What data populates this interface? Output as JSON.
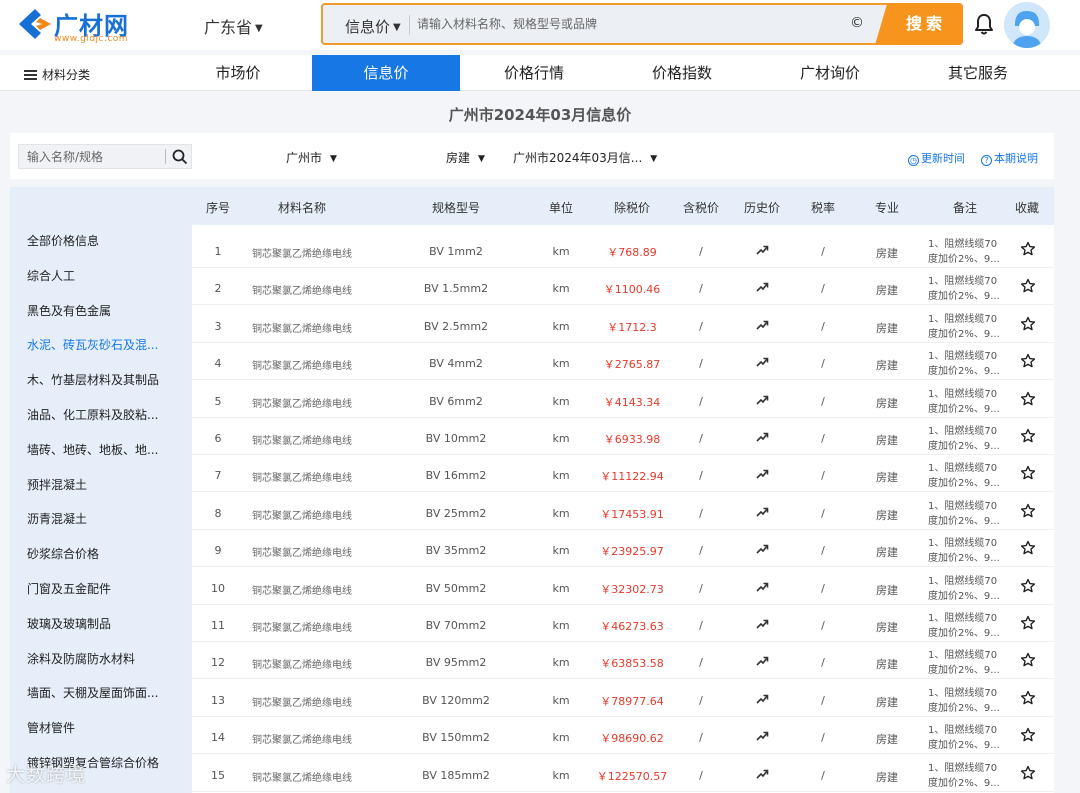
{
  "header": {
    "logo_name": "广材网",
    "logo_url": "www.gldjc.com",
    "province": "广东省",
    "search_type": "信息价",
    "search_placeholder": "请输入材料名称、规格型号或品牌",
    "copyright_symbol": "©",
    "search_button": "搜索"
  },
  "nav": {
    "category_label": "材料分类",
    "items": [
      "市场价",
      "信息价",
      "价格行情",
      "价格指数",
      "广材询价",
      "其它服务"
    ],
    "active": "信息价"
  },
  "page_title": "广州市2024年03月信息价",
  "filter": {
    "keyword_placeholder": "输入名称/规格",
    "city": "广州市",
    "major": "房建",
    "period": "广州市2024年03月信...",
    "update_time_link": "更新时间",
    "period_note_link": "本期说明"
  },
  "sidebar": {
    "items": [
      "全部价格信息",
      "综合人工",
      "黑色及有色金属",
      "水泥、砖瓦灰砂石及混...",
      "木、竹基层材料及其制品",
      "油品、化工原料及胶粘...",
      "墙砖、地砖、地板、地...",
      "预拌混凝土",
      "沥青混凝土",
      "砂浆综合价格",
      "门窗及五金配件",
      "玻璃及玻璃制品",
      "涂料及防腐防水材料",
      "墙面、天棚及屋面饰面...",
      "管材管件",
      "镀锌钢塑复合管综合价格"
    ],
    "active_index": 3
  },
  "table": {
    "headers": [
      "序号",
      "材料名称",
      "规格型号",
      "单位",
      "除税价",
      "含税价",
      "历史价",
      "税率",
      "专业",
      "备注",
      "收藏"
    ],
    "rows": [
      {
        "idx": "1",
        "name": "铜芯聚氯乙烯绝缘电线",
        "spec": "BV 1mm2",
        "unit": "km",
        "price": "￥768.89",
        "tax_price": "/",
        "rate": "/",
        "major": "房建",
        "note_line1": "1、阻燃线缆70",
        "note_line2": "度加价2%、9..."
      },
      {
        "idx": "2",
        "name": "铜芯聚氯乙烯绝缘电线",
        "spec": "BV 1.5mm2",
        "unit": "km",
        "price": "￥1100.46",
        "tax_price": "/",
        "rate": "/",
        "major": "房建",
        "note_line1": "1、阻燃线缆70",
        "note_line2": "度加价2%、9..."
      },
      {
        "idx": "3",
        "name": "铜芯聚氯乙烯绝缘电线",
        "spec": "BV 2.5mm2",
        "unit": "km",
        "price": "￥1712.3",
        "tax_price": "/",
        "rate": "/",
        "major": "房建",
        "note_line1": "1、阻燃线缆70",
        "note_line2": "度加价2%、9..."
      },
      {
        "idx": "4",
        "name": "铜芯聚氯乙烯绝缘电线",
        "spec": "BV 4mm2",
        "unit": "km",
        "price": "￥2765.87",
        "tax_price": "/",
        "rate": "/",
        "major": "房建",
        "note_line1": "1、阻燃线缆70",
        "note_line2": "度加价2%、9..."
      },
      {
        "idx": "5",
        "name": "铜芯聚氯乙烯绝缘电线",
        "spec": "BV 6mm2",
        "unit": "km",
        "price": "￥4143.34",
        "tax_price": "/",
        "rate": "/",
        "major": "房建",
        "note_line1": "1、阻燃线缆70",
        "note_line2": "度加价2%、9..."
      },
      {
        "idx": "6",
        "name": "铜芯聚氯乙烯绝缘电线",
        "spec": "BV 10mm2",
        "unit": "km",
        "price": "￥6933.98",
        "tax_price": "/",
        "rate": "/",
        "major": "房建",
        "note_line1": "1、阻燃线缆70",
        "note_line2": "度加价2%、9..."
      },
      {
        "idx": "7",
        "name": "铜芯聚氯乙烯绝缘电线",
        "spec": "BV 16mm2",
        "unit": "km",
        "price": "￥11122.94",
        "tax_price": "/",
        "rate": "/",
        "major": "房建",
        "note_line1": "1、阻燃线缆70",
        "note_line2": "度加价2%、9..."
      },
      {
        "idx": "8",
        "name": "铜芯聚氯乙烯绝缘电线",
        "spec": "BV 25mm2",
        "unit": "km",
        "price": "￥17453.91",
        "tax_price": "/",
        "rate": "/",
        "major": "房建",
        "note_line1": "1、阻燃线缆70",
        "note_line2": "度加价2%、9..."
      },
      {
        "idx": "9",
        "name": "铜芯聚氯乙烯绝缘电线",
        "spec": "BV 35mm2",
        "unit": "km",
        "price": "￥23925.97",
        "tax_price": "/",
        "rate": "/",
        "major": "房建",
        "note_line1": "1、阻燃线缆70",
        "note_line2": "度加价2%、9..."
      },
      {
        "idx": "10",
        "name": "铜芯聚氯乙烯绝缘电线",
        "spec": "BV 50mm2",
        "unit": "km",
        "price": "￥32302.73",
        "tax_price": "/",
        "rate": "/",
        "major": "房建",
        "note_line1": "1、阻燃线缆70",
        "note_line2": "度加价2%、9..."
      },
      {
        "idx": "11",
        "name": "铜芯聚氯乙烯绝缘电线",
        "spec": "BV 70mm2",
        "unit": "km",
        "price": "￥46273.63",
        "tax_price": "/",
        "rate": "/",
        "major": "房建",
        "note_line1": "1、阻燃线缆70",
        "note_line2": "度加价2%、9..."
      },
      {
        "idx": "12",
        "name": "铜芯聚氯乙烯绝缘电线",
        "spec": "BV 95mm2",
        "unit": "km",
        "price": "￥63853.58",
        "tax_price": "/",
        "rate": "/",
        "major": "房建",
        "note_line1": "1、阻燃线缆70",
        "note_line2": "度加价2%、9..."
      },
      {
        "idx": "13",
        "name": "铜芯聚氯乙烯绝缘电线",
        "spec": "BV 120mm2",
        "unit": "km",
        "price": "￥78977.64",
        "tax_price": "/",
        "rate": "/",
        "major": "房建",
        "note_line1": "1、阻燃线缆70",
        "note_line2": "度加价2%、9..."
      },
      {
        "idx": "14",
        "name": "铜芯聚氯乙烯绝缘电线",
        "spec": "BV 150mm2",
        "unit": "km",
        "price": "￥98690.62",
        "tax_price": "/",
        "rate": "/",
        "major": "房建",
        "note_line1": "1、阻燃线缆70",
        "note_line2": "度加价2%、9..."
      },
      {
        "idx": "15",
        "name": "铜芯聚氯乙烯绝缘电线",
        "spec": "BV 185mm2",
        "unit": "km",
        "price": "￥122570.57",
        "tax_price": "/",
        "rate": "/",
        "major": "房建",
        "note_line1": "1、阻燃线缆70",
        "note_line2": "度加价2%、9..."
      }
    ]
  },
  "watermark": "大数跨境",
  "icons": {
    "history": "trend-arrow-icon",
    "favorite": "star-outline-icon",
    "search": "magnifier-icon",
    "notifications": "bell-icon",
    "user": "avatar-icon",
    "categories": "menu-icon"
  },
  "colors": {
    "brand_blue": "#1677e5",
    "accent_orange": "#f7941d",
    "price_red": "#e8382b",
    "sidebar_bg": "#e6eefa"
  }
}
